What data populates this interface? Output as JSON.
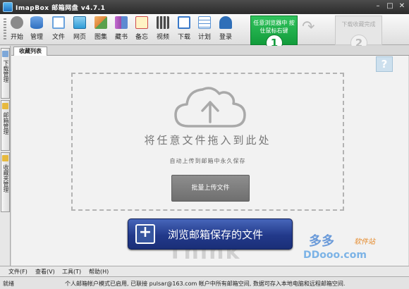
{
  "window": {
    "title": "ImapBox 邮箱网盘 v4.7.1",
    "controls": {
      "minimize": "–",
      "maximize": "□",
      "close": "✕"
    }
  },
  "toolbar": {
    "items": [
      {
        "label": "开始",
        "icon": "gear-icon",
        "color": "#8a8a8a"
      },
      {
        "label": "管理",
        "icon": "database-icon",
        "color": "#3d7fd0"
      },
      {
        "label": "文件",
        "icon": "file-icon",
        "color": "#6aa3dd"
      },
      {
        "label": "网页",
        "icon": "webpage-icon",
        "color": "#2f9cd7"
      },
      {
        "label": "图集",
        "icon": "gallery-icon",
        "color": "#e0873b"
      },
      {
        "label": "藏书",
        "icon": "book-icon",
        "color": "#9b4aa8"
      },
      {
        "label": "备忘",
        "icon": "memo-icon",
        "color": "#cf4b4b"
      },
      {
        "label": "视频",
        "icon": "video-icon",
        "color": "#4a4a4a"
      },
      {
        "label": "下载",
        "icon": "download-icon",
        "color": "#3a79c9"
      },
      {
        "label": "计划",
        "icon": "calendar-icon",
        "color": "#5a93d4"
      },
      {
        "label": "登录",
        "icon": "login-icon",
        "color": "#2f6fb8"
      }
    ]
  },
  "tutorial": {
    "step1": {
      "text": "任意浏览器中 按住鼠标右键",
      "number": "1"
    },
    "step2": {
      "text": "下载收藏完成",
      "number": "2"
    },
    "arrow": "↷"
  },
  "sidebar": {
    "tabs": [
      {
        "label": "下载管理",
        "icon": "download-icon"
      },
      {
        "label": "邮箱管理",
        "icon": "mailbox-icon"
      },
      {
        "label": "收藏夹管理",
        "icon": "favorites-icon"
      }
    ]
  },
  "main": {
    "tab_label": "收藏列表",
    "help": "?",
    "drop_title": "将任意文件拖入到此处",
    "drop_subtitle": "自动上传到邮箱中永久保存",
    "batch_upload_label": "批量上传文件",
    "browse_label": "浏览邮箱保存的文件"
  },
  "watermarks": {
    "think": "Think",
    "site_name": "多多",
    "site_tag": "软件站",
    "site_url": "DDooo.com"
  },
  "menubar": {
    "items": [
      "文件(F)",
      "查看(V)",
      "工具(T)",
      "帮助(H)"
    ]
  },
  "status": {
    "left": "就绪",
    "message": "个人邮箱帐户模式已启用, 已联接 pulsar@163.com 帐户中所有邮箱空间, 数据可存入本地电脑和远程邮箱空间."
  }
}
